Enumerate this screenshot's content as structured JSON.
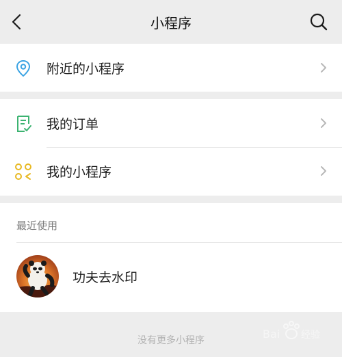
{
  "header": {
    "title": "小程序",
    "back_icon": "back-chevron-icon",
    "search_icon": "search-icon"
  },
  "menu": [
    {
      "label": "附近的小程序",
      "icon": "location-pin-icon",
      "icon_color": "#3aa3e3"
    },
    {
      "label": "我的订单",
      "icon": "order-checklist-icon",
      "icon_color": "#3cb371"
    },
    {
      "label": "我的小程序",
      "icon": "mini-program-grid-icon",
      "icon_color": "#e8b923"
    }
  ],
  "recent": {
    "header": "最近使用",
    "apps": [
      {
        "name": "功夫去水印",
        "avatar": "kung-fu-panda-avatar"
      }
    ]
  },
  "footer": {
    "text": "没有更多小程序"
  },
  "colors": {
    "background": "#ededed",
    "card": "#ffffff",
    "secondary_text": "#7a7a7a"
  }
}
